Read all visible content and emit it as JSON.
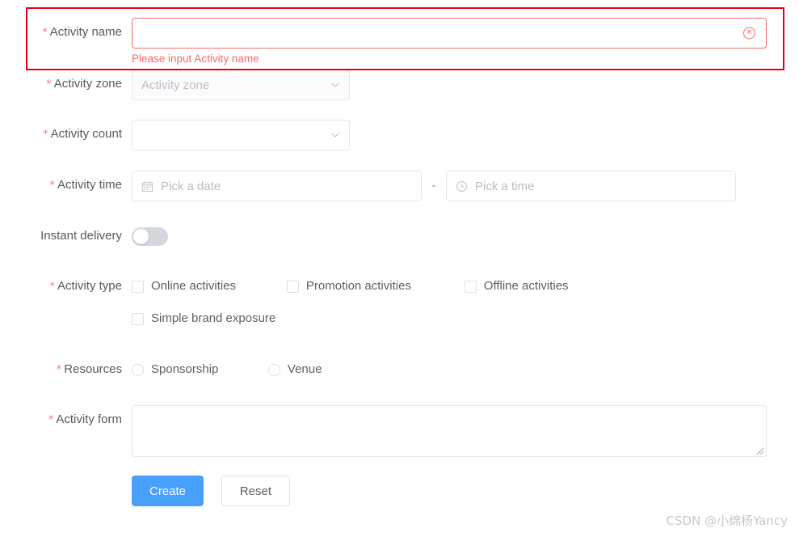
{
  "annotation": {
    "present": true,
    "color": "#e60012"
  },
  "theme": {
    "required_mark_color": "#f5797e",
    "error_color": "#f76a6f",
    "primary_color": "#49a0fb",
    "border_color": "#e4e6ea",
    "label_color": "#595959",
    "placeholder_color": "#b9bdc4"
  },
  "form": {
    "rows": {
      "activity_name": {
        "label": "Activity name",
        "required": true,
        "value": "",
        "placeholder": "",
        "error": "Please input Activity name",
        "clear_icon": "close-circle-icon"
      },
      "activity_zone": {
        "label": "Activity zone",
        "required": true,
        "placeholder": "Activity zone",
        "value": "",
        "disabled": true,
        "arrow_icon": "chevron-down-icon"
      },
      "activity_count": {
        "label": "Activity count",
        "required": true,
        "placeholder": "",
        "value": "",
        "disabled": false,
        "arrow_icon": "chevron-down-icon"
      },
      "activity_time": {
        "label": "Activity time",
        "required": true,
        "date_placeholder": "Pick a date",
        "date_value": "",
        "date_icon": "calendar-icon",
        "separator": "-",
        "time_placeholder": "Pick a time",
        "time_value": "",
        "time_icon": "clock-icon"
      },
      "instant_delivery": {
        "label": "Instant delivery",
        "required": false,
        "checked": false
      },
      "activity_type": {
        "label": "Activity type",
        "required": true,
        "options": [
          {
            "label": "Online activities",
            "checked": false
          },
          {
            "label": "Promotion activities",
            "checked": false
          },
          {
            "label": "Offline activities",
            "checked": false
          },
          {
            "label": "Simple brand exposure",
            "checked": false
          }
        ]
      },
      "resources": {
        "label": "Resources",
        "required": true,
        "options": [
          {
            "label": "Sponsorship",
            "selected": false
          },
          {
            "label": "Venue",
            "selected": false
          }
        ]
      },
      "activity_form": {
        "label": "Activity form",
        "required": true,
        "value": "",
        "placeholder": ""
      }
    },
    "actions": {
      "submit_label": "Create",
      "reset_label": "Reset"
    }
  },
  "watermark": {
    "text": "CSDN @小绵杨Yancy"
  }
}
